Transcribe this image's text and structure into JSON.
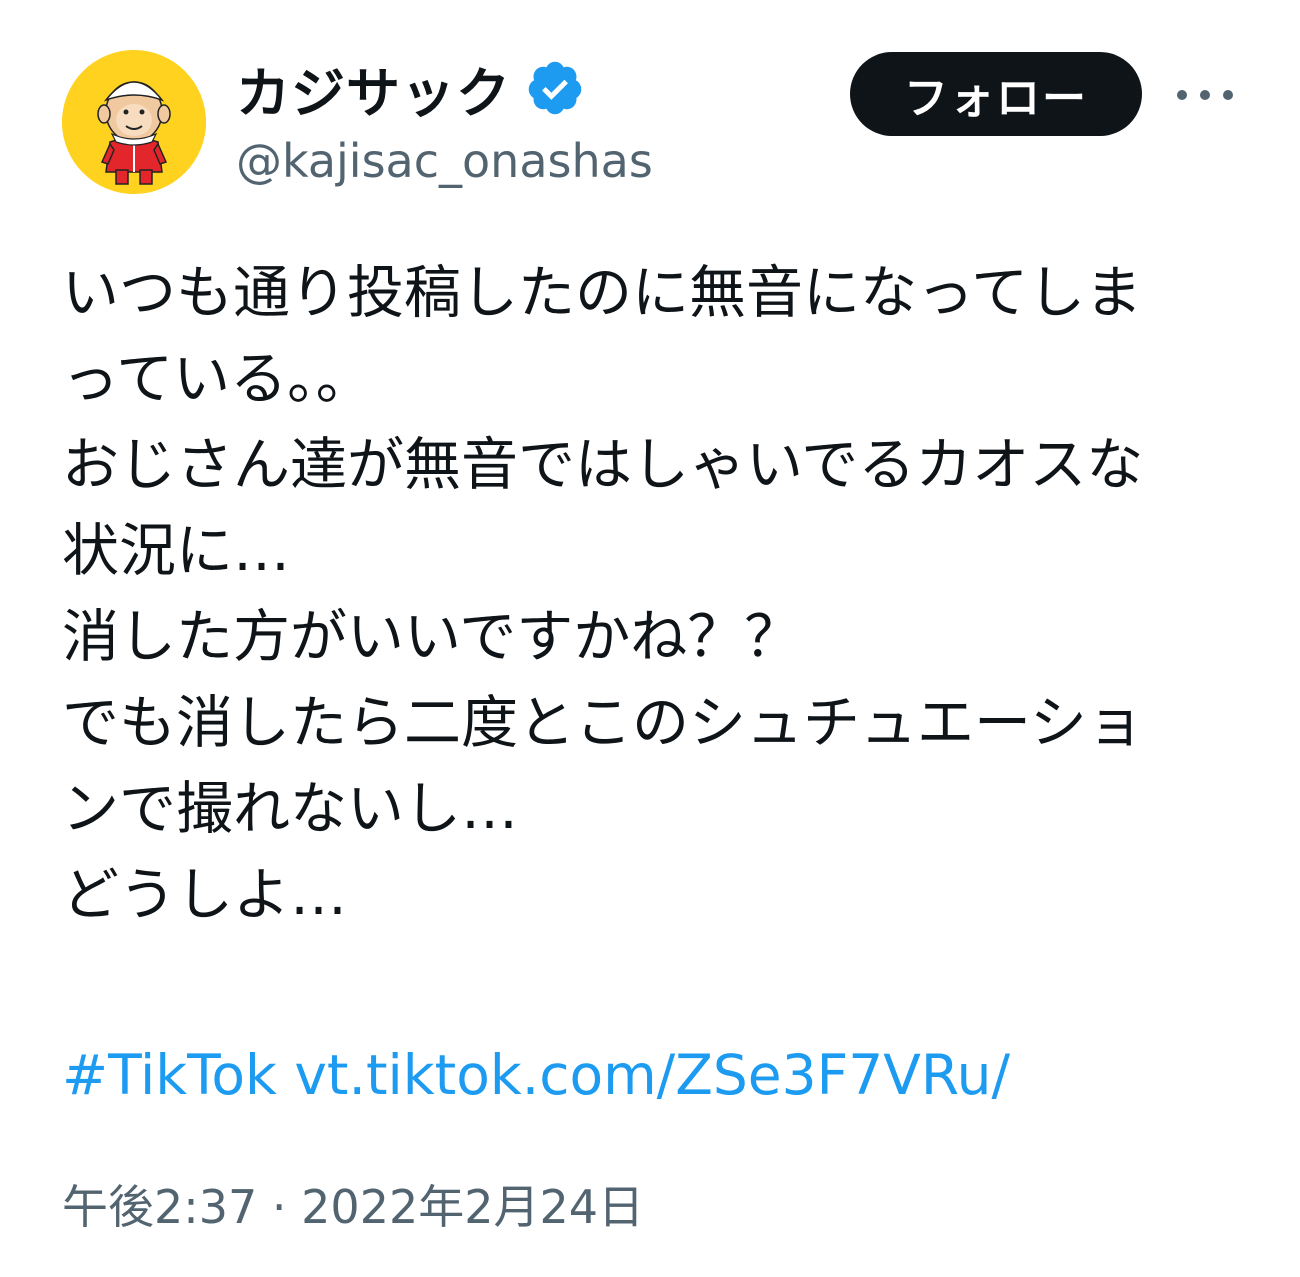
{
  "author": {
    "display_name": "カジサック",
    "handle": "@kajisac_onashas",
    "verified": true,
    "avatar_bg_color": "#ffd21f",
    "verified_color": "#1d9bf0"
  },
  "actions": {
    "follow_label": "フォロー",
    "more_icon": "more-horizontal-icon"
  },
  "tweet": {
    "lines": [
      "いつも通り投稿したのに無音になってしま",
      "っている。。",
      "おじさん達が無音ではしゃいでるカオスな",
      "状況に…",
      "消した方がいいですかね？？",
      "でも消したら二度とこのシュチュエーショ",
      "ンで撮れないし…",
      "どうしよ…"
    ],
    "hashtag": "#TikTok",
    "link": "vt.tiktok.com/ZSe3F7VRu/",
    "link_color": "#1d9bf0"
  },
  "meta": {
    "timestamp": "午後2:37 · 2022年2月24日"
  }
}
